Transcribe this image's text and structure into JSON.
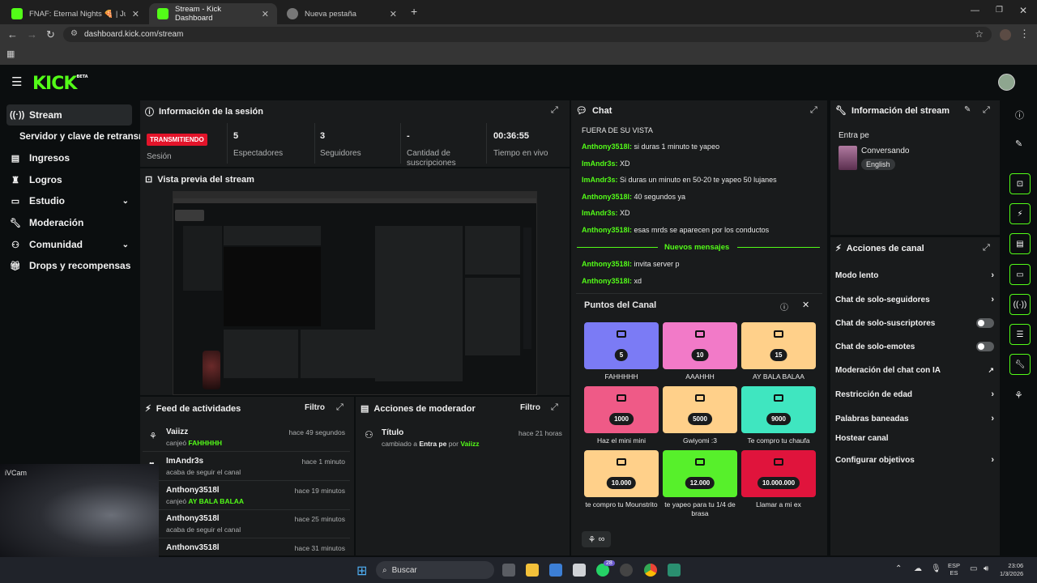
{
  "browser": {
    "tabs": [
      {
        "title": "FNAF: Eternal Nights 🍕 | Juegu"
      },
      {
        "title": "Stream - Kick Dashboard"
      },
      {
        "title": "Nueva pestaña"
      }
    ],
    "url": "dashboard.kick.com/stream"
  },
  "kick": {
    "logo": "KICK",
    "logo_badge": "BETA"
  },
  "sidebar": {
    "items": [
      {
        "label": "Stream",
        "icon": "broadcast-icon"
      },
      {
        "label": "Servidor y clave de retransm"
      },
      {
        "label": "Ingresos",
        "icon": "chart-icon"
      },
      {
        "label": "Logros",
        "icon": "trophy-icon"
      },
      {
        "label": "Estudio",
        "icon": "studio-icon"
      },
      {
        "label": "Moderación",
        "icon": "wrench-icon"
      },
      {
        "label": "Comunidad",
        "icon": "community-icon"
      },
      {
        "label": "Drops y recompensas",
        "icon": "gift-icon"
      }
    ]
  },
  "session": {
    "title": "Información de la sesión",
    "status_badge": "TRANSMITIENDO",
    "status_label": "Sesión",
    "viewers": "5",
    "viewers_label": "Espectadores",
    "followers": "3",
    "followers_label": "Seguidores",
    "subs": "-",
    "subs_label": "Cantidad de suscripciones",
    "uptime": "00:36:55",
    "uptime_label": "Tiempo en vivo"
  },
  "preview": {
    "title": "Vista previa del stream"
  },
  "feed": {
    "title": "Feed de actividades",
    "filter": "Filtro",
    "rows": [
      {
        "user": "Vaiizz",
        "time": "hace 49 segundos",
        "pre": "canjeó ",
        "detail": "FAHHHHH"
      },
      {
        "user": "ImAndr3s",
        "time": "hace 1 minuto",
        "pre": "acaba de seguir el canal",
        "detail": ""
      },
      {
        "user": "Anthony3518l",
        "time": "hace 19 minutos",
        "pre": "canjeó ",
        "detail": "AY BALA BALAA"
      },
      {
        "user": "Anthony3518l",
        "time": "hace 25 minutos",
        "pre": "acaba de seguir el canal",
        "detail": ""
      },
      {
        "user": "Anthonv3518l",
        "time": "hace 31 minutos",
        "pre": "",
        "detail": ""
      }
    ]
  },
  "modactions": {
    "title": "Acciones de moderador",
    "filter": "Filtro",
    "row": {
      "title": "Título",
      "time": "hace 21 horas",
      "pre": "cambiado a ",
      "value": "Entra pe",
      "by": " por ",
      "user": "Vaiizz"
    }
  },
  "chat": {
    "title": "Chat",
    "lines": [
      {
        "user": "",
        "text": "FUERA DE SU VISTA"
      },
      {
        "user": "Anthony3518l:",
        "text": " si duras 1 minuto te yapeo"
      },
      {
        "user": "ImAndr3s:",
        "text": " XD"
      },
      {
        "user": "ImAndr3s:",
        "text": " Si duras un minuto en 50-20 te yapeo 50 lujanes"
      },
      {
        "user": "Anthony3518l:",
        "text": " 40 segundos ya"
      },
      {
        "user": "ImAndr3s:",
        "text": " XD"
      },
      {
        "user": "Anthony3518l:",
        "text": " esas mrds se aparecen por los conductos"
      }
    ],
    "new_messages": "Nuevos mensajes",
    "new_lines": [
      {
        "user": "Anthony3518l:",
        "text": " invita server p"
      },
      {
        "user": "Anthony3518l:",
        "text": " xd"
      }
    ],
    "infinity": "∞"
  },
  "points": {
    "title": "Puntos del Canal",
    "rewards": [
      {
        "cost": "5",
        "label": "FAHHHHH",
        "color": "#7b7bf5"
      },
      {
        "cost": "10",
        "label": "AAAHHH",
        "color": "#f27ac8"
      },
      {
        "cost": "15",
        "label": "AY BALA BALAA",
        "color": "#ffd08a"
      },
      {
        "cost": "1000",
        "label": "Haz el mini mini",
        "color": "#ef5a87"
      },
      {
        "cost": "5000",
        "label": "Gwiyomi :3",
        "color": "#ffd08a"
      },
      {
        "cost": "9000",
        "label": "Te compro tu chaufa",
        "color": "#3fe6c0"
      },
      {
        "cost": "10.000",
        "label": "te compro tu Mounstrito",
        "color": "#ffd08a"
      },
      {
        "cost": "12.000",
        "label": "te yapeo para tu 1/4 de brasa",
        "color": "#57f02b"
      },
      {
        "cost": "10.000.000",
        "label": "Llamar a mi ex",
        "color": "#e0143c"
      }
    ]
  },
  "stream_info": {
    "title": "Información del stream",
    "stream_title": "Entra pe",
    "category": "Conversando",
    "language": "English"
  },
  "channel_actions": {
    "title": "Acciones de canal",
    "items": [
      {
        "label": "Modo lento",
        "kind": "chevron"
      },
      {
        "label": "Chat de solo-seguidores",
        "kind": "chevron"
      },
      {
        "label": "Chat de solo-suscriptores",
        "kind": "toggle"
      },
      {
        "label": "Chat de solo-emotes",
        "kind": "toggle"
      },
      {
        "label": "Moderación del chat con IA",
        "kind": "external"
      },
      {
        "label": "Restricción de edad",
        "kind": "chevron"
      },
      {
        "label": "Palabras baneadas",
        "kind": "chevron"
      },
      {
        "label": "Hostear canal",
        "kind": "none"
      },
      {
        "label": "Configurar objetivos",
        "kind": "chevron"
      }
    ]
  },
  "overlay": {
    "cam_label": "iVCam"
  },
  "taskbar": {
    "search": "Buscar",
    "lang_top": "ESP",
    "lang_bottom": "ES",
    "time": "23:06",
    "date": "1/3/2026",
    "chat_badge": "28"
  },
  "colors": {
    "accent": "#53fc18",
    "panel": "#191b1c",
    "live": "#e3142a"
  }
}
